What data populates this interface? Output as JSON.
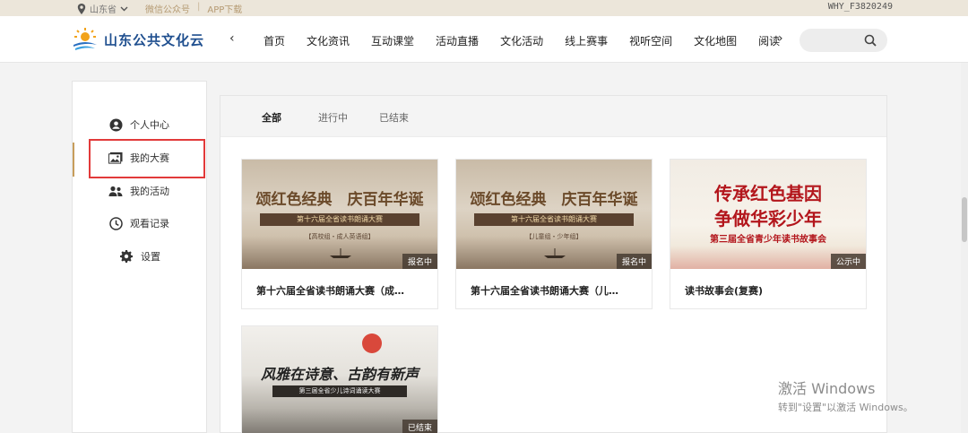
{
  "topbar": {
    "province": "山东省",
    "wechat": "微信公众号",
    "app": "APP下载",
    "user_id": "WHY_F3820249"
  },
  "header": {
    "logo_text": "山东公共文化云",
    "nav": [
      "首页",
      "文化资讯",
      "互动课堂",
      "活动直播",
      "文化活动",
      "线上赛事",
      "视听空间",
      "文化地图",
      "阅读"
    ]
  },
  "sidebar": {
    "items": [
      {
        "label": "个人中心",
        "icon": "user-circle-icon"
      },
      {
        "label": "我的大赛",
        "icon": "gallery-icon"
      },
      {
        "label": "我的活动",
        "icon": "people-icon"
      },
      {
        "label": "观看记录",
        "icon": "clock-icon"
      },
      {
        "label": "设置",
        "icon": "gear-icon"
      }
    ]
  },
  "tabs": [
    "全部",
    "进行中",
    "已结束"
  ],
  "cards": [
    {
      "title": "第十六届全省读书朗诵大赛（成…",
      "badge": "报名中",
      "banner_main": "颂红色经典　庆百年华诞",
      "banner_sub": "第十六届全省读书朗诵大赛",
      "banner_group": "【高校组・成人英语组】"
    },
    {
      "title": "第十六届全省读书朗诵大赛（儿…",
      "badge": "报名中",
      "banner_main": "颂红色经典　庆百年华诞",
      "banner_sub": "第十六届全省读书朗诵大赛",
      "banner_group": "【儿童组・少年组】"
    },
    {
      "title": "读书故事会(复赛)",
      "badge": "公示中",
      "banner_main1": "传承红色基因",
      "banner_main2": "争做华彩少年",
      "banner_sub": "第三届全省青少年读书故事会"
    },
    {
      "title": "",
      "badge": "已结束",
      "banner_main": "风雅在诗意、古韵有新声",
      "banner_sub": "第三届全省少儿诗词诵读大赛"
    }
  ],
  "watermark": {
    "line1": "激活 Windows",
    "line2": "转到\"设置\"以激活 Windows。"
  }
}
